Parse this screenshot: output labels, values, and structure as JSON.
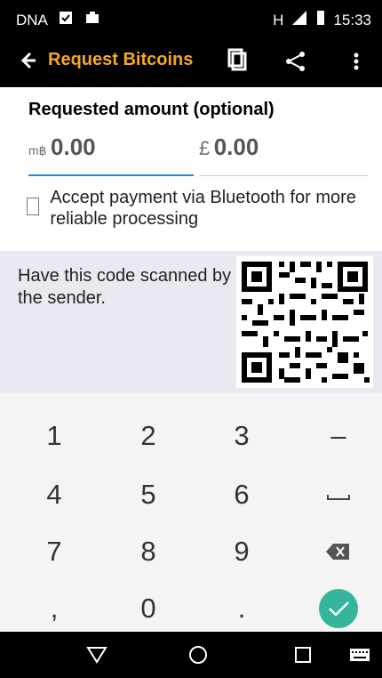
{
  "status_bar": {
    "left_text": "DNA",
    "network": "H",
    "time": "15:33",
    "icons": [
      "clipboard-check-icon",
      "briefcase-icon",
      "signal-icon",
      "battery-icon"
    ]
  },
  "app_bar": {
    "title": "Request Bitcoins",
    "icons": [
      "back-arrow-icon",
      "copy-icon",
      "share-icon",
      "more-vert-icon"
    ],
    "accent": "#f6a821"
  },
  "form": {
    "heading": "Requested amount (optional)",
    "bitcoin_prefix": "m฿",
    "bitcoin_value": "0.00",
    "fiat_prefix": "£",
    "fiat_value": "0.00",
    "bluetooth_checkbox_label": "Accept payment via Bluetooth for more reliable processing",
    "bluetooth_checked": false
  },
  "qr_section": {
    "instruction": "Have this code scanned by the sender."
  },
  "keypad": {
    "keys": [
      "1",
      "2",
      "3",
      "–",
      "4",
      "5",
      "6",
      "␣",
      "7",
      "8",
      "9",
      "⌫",
      ",",
      "0",
      ".",
      "✓"
    ],
    "accent": "#35b59b"
  },
  "nav_bar": {
    "icons": [
      "back-triangle-icon",
      "home-circle-icon",
      "recents-square-icon",
      "keyboard-icon"
    ]
  }
}
